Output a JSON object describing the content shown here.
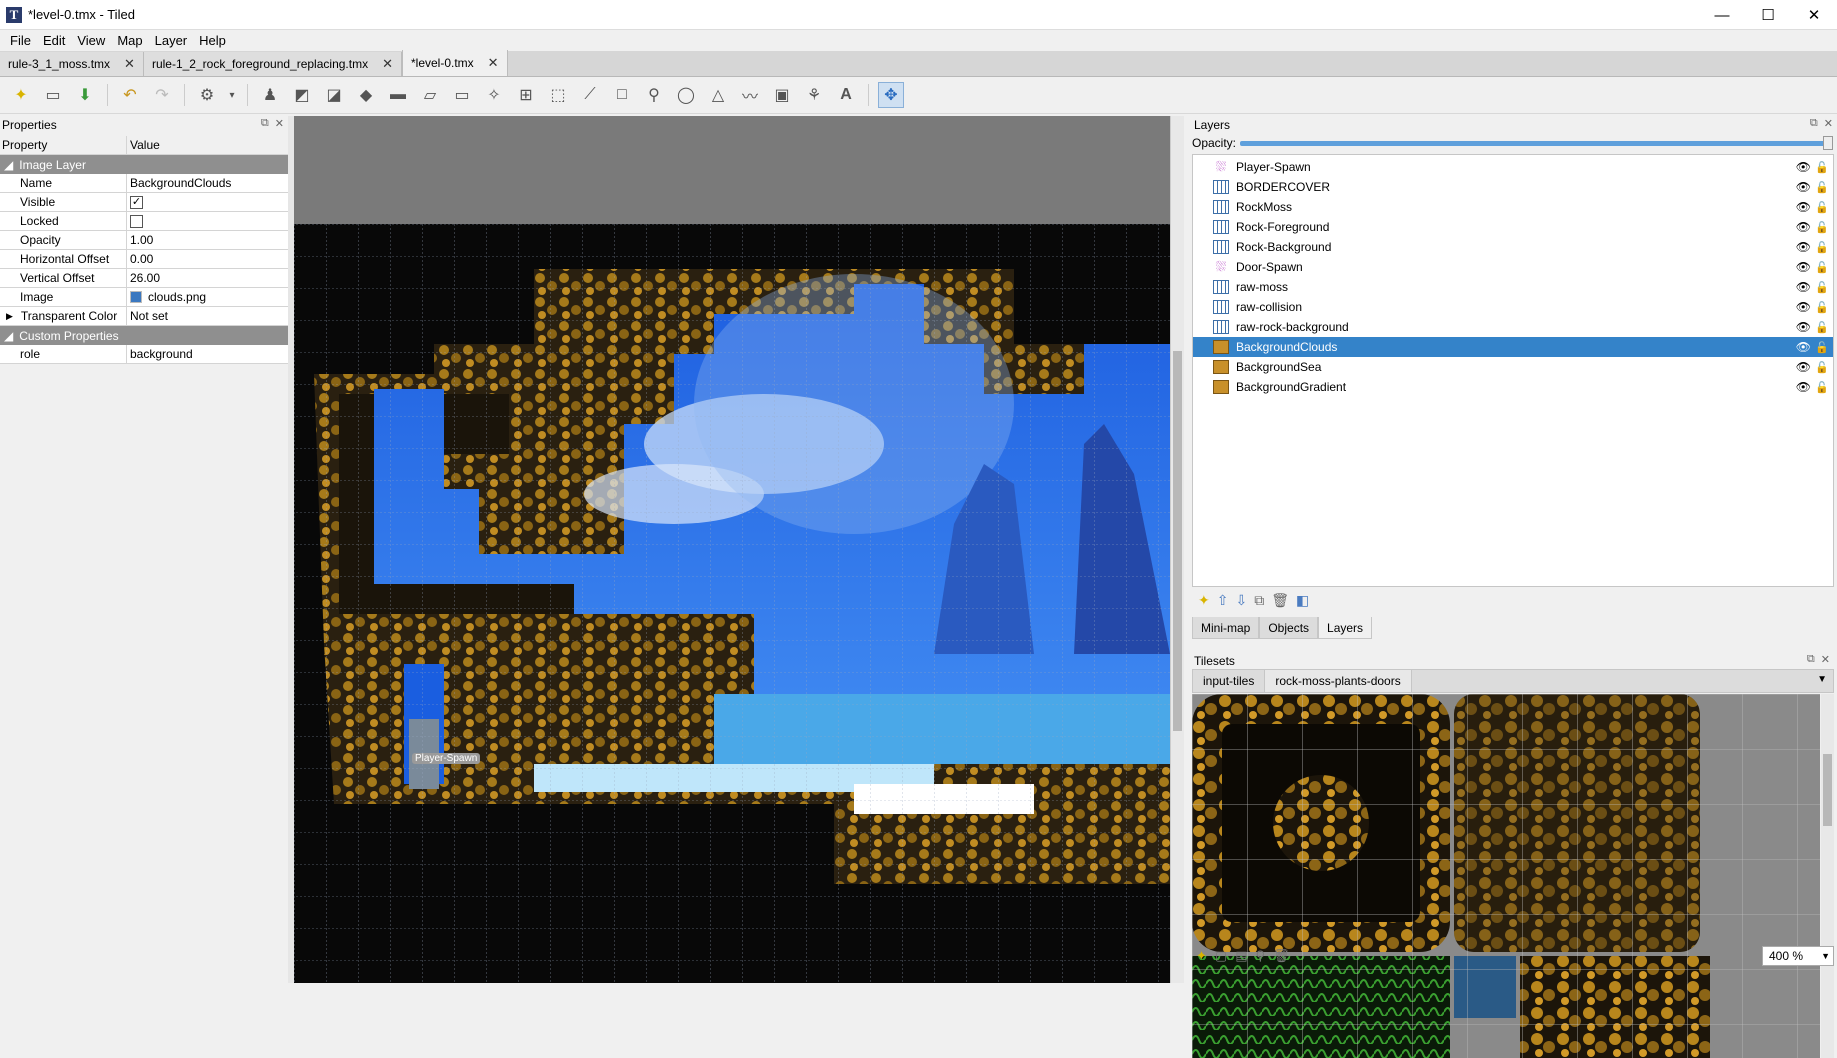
{
  "window": {
    "title": "*level-0.tmx - Tiled",
    "logo": "T",
    "minimize": "—",
    "maximize": "☐",
    "close": "✕"
  },
  "menu": [
    "File",
    "Edit",
    "View",
    "Map",
    "Layer",
    "Help"
  ],
  "tabs": [
    {
      "label": "rule-3_1_moss.tmx",
      "active": false
    },
    {
      "label": "rule-1_2_rock_foreground_replacing.tmx",
      "active": false
    },
    {
      "label": "*level-0.tmx",
      "active": true
    }
  ],
  "properties": {
    "title": "Properties",
    "col_property": "Property",
    "col_value": "Value",
    "group_image_layer": "Image Layer",
    "rows": [
      {
        "k": "Name",
        "v": "BackgroundClouds"
      },
      {
        "k": "Visible",
        "v": ""
      },
      {
        "k": "Locked",
        "v": ""
      },
      {
        "k": "Opacity",
        "v": "1.00"
      },
      {
        "k": "Horizontal Offset",
        "v": "0.00"
      },
      {
        "k": "Vertical Offset",
        "v": "26.00"
      },
      {
        "k": "Image",
        "v": "clouds.png"
      },
      {
        "k": "Transparent Color",
        "v": "Not set"
      }
    ],
    "visible_checked": true,
    "locked_checked": false,
    "group_custom": "Custom Properties",
    "custom_rows": [
      {
        "k": "role",
        "v": "background"
      }
    ]
  },
  "map": {
    "spawn_label": "Player-Spawn"
  },
  "layers": {
    "title": "Layers",
    "opacity_label": "Opacity:",
    "opacity": 1.0,
    "items": [
      {
        "name": "Player-Spawn",
        "type": "obj"
      },
      {
        "name": "BORDERCOVER",
        "type": "tile"
      },
      {
        "name": "RockMoss",
        "type": "tile"
      },
      {
        "name": "Rock-Foreground",
        "type": "tile"
      },
      {
        "name": "Rock-Background",
        "type": "tile"
      },
      {
        "name": "Door-Spawn",
        "type": "obj"
      },
      {
        "name": "raw-moss",
        "type": "tile"
      },
      {
        "name": "raw-collision",
        "type": "tile"
      },
      {
        "name": "raw-rock-background",
        "type": "tile"
      },
      {
        "name": "BackgroundClouds",
        "type": "img",
        "selected": true
      },
      {
        "name": "BackgroundSea",
        "type": "img"
      },
      {
        "name": "BackgroundGradient",
        "type": "img"
      }
    ]
  },
  "dock_tabs": [
    "Mini-map",
    "Objects",
    "Layers"
  ],
  "tilesets": {
    "title": "Tilesets",
    "tabs": [
      "input-tiles",
      "rock-moss-plants-doors"
    ],
    "active": 1
  },
  "zoom": "400 %"
}
